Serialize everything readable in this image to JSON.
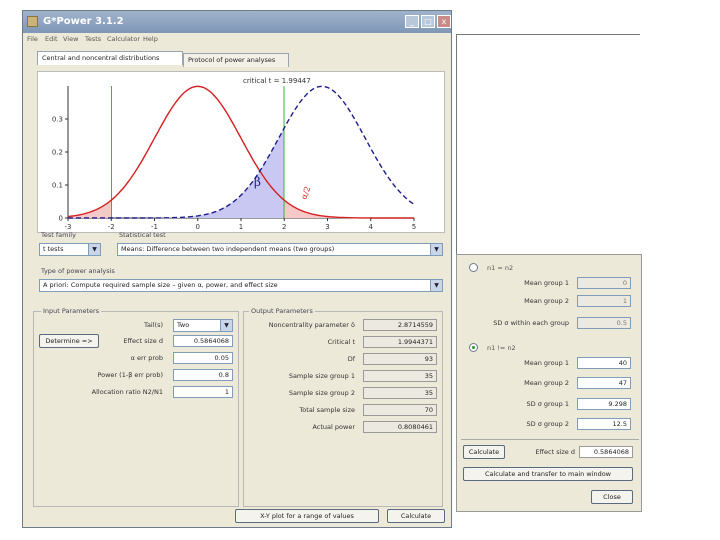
{
  "window": {
    "title": "G*Power 3.1.2",
    "menu": [
      "File",
      "Edit",
      "View",
      "Tests",
      "Calculator",
      "Help"
    ],
    "tabs": [
      "Central and noncentral distributions",
      "Protocol of power analyses"
    ],
    "critical_t_label": "critical t = 1.99447",
    "y_ticks": [
      "0.3",
      "0.2",
      "0.1",
      "0"
    ],
    "x_ticks": [
      "-3",
      "-2",
      "-1",
      "0",
      "1",
      "2",
      "3",
      "4",
      "5"
    ],
    "beta_label": "β",
    "alpha_label": "α/2"
  },
  "test_family": {
    "label": "Test family",
    "value": "t tests"
  },
  "statistical_test": {
    "label": "Statistical test",
    "value": "Means: Difference between two independent means (two groups)"
  },
  "power_analysis": {
    "label": "Type of power analysis",
    "value": "A priori: Compute required sample size – given α, power, and effect size"
  },
  "input": {
    "label": "Input Parameters",
    "determine_label": "Determine =>",
    "rows": [
      {
        "label": "Tail(s)",
        "value": "Two"
      },
      {
        "label": "Effect size d",
        "value": "0.5864068"
      },
      {
        "label": "α err prob",
        "value": "0.05"
      },
      {
        "label": "Power (1-β err prob)",
        "value": "0.8"
      },
      {
        "label": "Allocation ratio N2/N1",
        "value": "1"
      }
    ]
  },
  "output": {
    "label": "Output Parameters",
    "rows": [
      {
        "label": "Noncentrality parameter δ",
        "value": "2.8714559"
      },
      {
        "label": "Critical t",
        "value": "1.9944371"
      },
      {
        "label": "Df",
        "value": "93"
      },
      {
        "label": "Sample size group 1",
        "value": "35"
      },
      {
        "label": "Sample size group 2",
        "value": "35"
      },
      {
        "label": "Total sample size",
        "value": "70"
      },
      {
        "label": "Actual power",
        "value": "0.8080461"
      }
    ]
  },
  "buttons": {
    "xy_plot": "X-Y plot for a range of values",
    "calculate": "Calculate"
  },
  "panel": {
    "option1_label": "n1 = n2",
    "group1_rows": [
      {
        "label": "Mean group 1",
        "value": "0"
      },
      {
        "label": "Mean group 2",
        "value": "1"
      },
      {
        "label": "SD σ within each group",
        "value": "0.5"
      }
    ],
    "option2_label": "n1 != n2",
    "group2_rows": [
      {
        "label": "Mean group 1",
        "value": "40"
      },
      {
        "label": "Mean group 2",
        "value": "47"
      },
      {
        "label": "SD σ group 1",
        "value": "9.298"
      },
      {
        "label": "SD σ group 2",
        "value": "12.5"
      }
    ],
    "calculate_label": "Calculate",
    "effect_label": "Effect size d",
    "effect_value": "0.5864068",
    "transfer_label": "Calculate and transfer to main window",
    "close_label": "Close"
  },
  "colors": {
    "central": "#d42020",
    "noncentral": "#1c1c8c",
    "critical_line": "#3bb33b",
    "alpha_fill": "#f6c8c8",
    "beta_fill": "#c8c8f2"
  },
  "chart_data": {
    "type": "line",
    "x_range": [
      -3,
      5
    ],
    "y_range": [
      0,
      0.4
    ],
    "y_ticks": [
      0,
      0.1,
      0.2,
      0.3
    ],
    "x_ticks": [
      -3,
      -2,
      -1,
      0,
      1,
      2,
      3,
      4,
      5
    ],
    "series": [
      {
        "style": "solid",
        "color": "#d42020",
        "center": 0,
        "peak": 0.4
      },
      {
        "style": "dashed",
        "color": "#1c1c8c",
        "center": 2.8714559,
        "peak": 0.4
      }
    ],
    "critical_values": [
      -1.99447,
      1.99447
    ],
    "annotations": [
      "β",
      "α/2"
    ]
  }
}
